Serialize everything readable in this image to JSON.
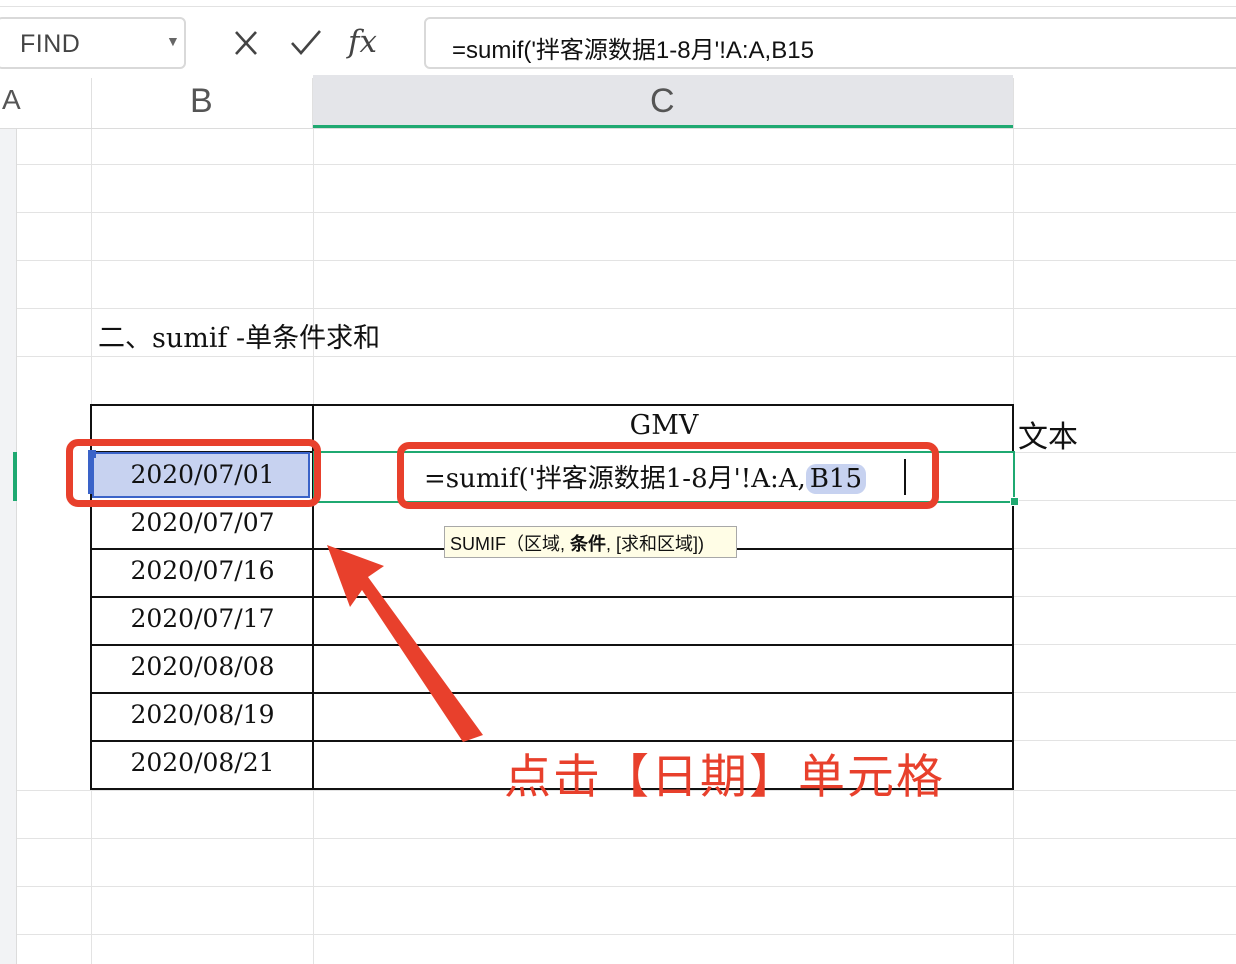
{
  "formula_bar": {
    "name_box": "FIND",
    "fx_label": "fx",
    "formula": "=sumif('拌客源数据1-8月'!A:A,B15"
  },
  "columns": {
    "a": "A",
    "b": "B",
    "c": "C"
  },
  "sheet": {
    "section_title": "二、sumif -单条件求和",
    "gmv_header": "GMV",
    "text_label": "文本",
    "dates": [
      "2020/07/01",
      "2020/07/07",
      "2020/07/16",
      "2020/07/17",
      "2020/08/08",
      "2020/08/19",
      "2020/08/21"
    ],
    "edit_formula_prefix": "=sumif('拌客源数据1-8月'!A:A,",
    "edit_formula_ref": "B15"
  },
  "tooltip": {
    "func": "SUMIF",
    "open": "（区域, ",
    "active": "条件",
    "rest": ", [求和区域])"
  },
  "annotation": {
    "text": "点击【日期】单元格",
    "color": "#e8402c"
  },
  "colors": {
    "accent": "#1fa971",
    "ref": "#3a63c8",
    "ref_fill": "#c7d2f0"
  }
}
